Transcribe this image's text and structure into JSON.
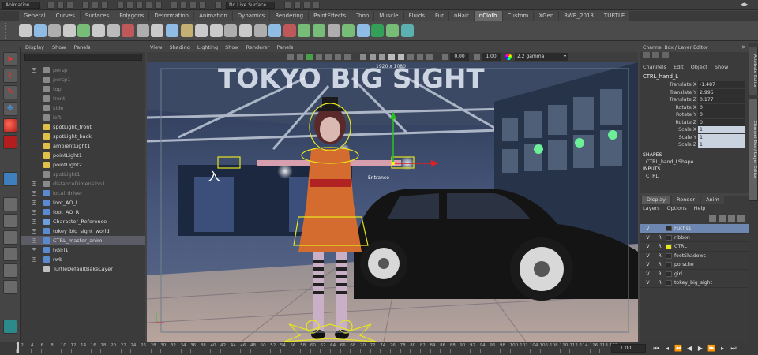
{
  "topbar": {
    "mode_field": "Animation",
    "surface_field": "No Live Surface"
  },
  "shelf_tabs": [
    "General",
    "Curves",
    "Surfaces",
    "Polygons",
    "Deformation",
    "Animation",
    "Dynamics",
    "Rendering",
    "PaintEffects",
    "Toon",
    "Muscle",
    "Fluids",
    "Fur",
    "nHair",
    "nCloth",
    "Custom",
    "XGen",
    "RWB_2013",
    "TURTLE"
  ],
  "active_shelf_tab": "nCloth",
  "outliner": {
    "menu": [
      "Display",
      "Show",
      "Panels"
    ],
    "items": [
      {
        "label": "persp",
        "dim": true,
        "exp": true
      },
      {
        "label": "persp1",
        "dim": true,
        "exp": false
      },
      {
        "label": "top",
        "dim": true,
        "exp": false
      },
      {
        "label": "front",
        "dim": true,
        "exp": false
      },
      {
        "label": "side",
        "dim": true,
        "exp": false
      },
      {
        "label": "left",
        "dim": true,
        "exp": false
      },
      {
        "label": "spotLight_front",
        "dim": false,
        "exp": false
      },
      {
        "label": "spotLight_back",
        "dim": false,
        "exp": false
      },
      {
        "label": "ambientLight1",
        "dim": false,
        "exp": false
      },
      {
        "label": "pointLight1",
        "dim": false,
        "exp": false
      },
      {
        "label": "pointLight2",
        "dim": false,
        "exp": false
      },
      {
        "label": "spotLight1",
        "dim": true,
        "exp": false
      },
      {
        "label": "distanceDimension1",
        "dim": true,
        "exp": true
      },
      {
        "label": "local_driver",
        "dim": true,
        "exp": true
      },
      {
        "label": "foot_AO_L",
        "dim": false,
        "exp": true
      },
      {
        "label": "foot_AO_R",
        "dim": false,
        "exp": true
      },
      {
        "label": "Character_Reference",
        "dim": false,
        "exp": true
      },
      {
        "label": "tokey_big_sight_world",
        "dim": false,
        "exp": true
      },
      {
        "label": "CTRL_master_anim",
        "dim": false,
        "exp": true,
        "sel": true
      },
      {
        "label": "hGirl1",
        "dim": false,
        "exp": true
      },
      {
        "label": "rwb",
        "dim": false,
        "exp": true
      },
      {
        "label": "TurtleDefaultBakeLayer",
        "dim": false,
        "exp": false
      }
    ]
  },
  "viewport": {
    "menu": [
      "View",
      "Shading",
      "Lighting",
      "Show",
      "Renderer",
      "Panels"
    ],
    "exposure": "0.00",
    "gamma_value": "1.00",
    "gamma_mode": "2.2 gamma",
    "resolution_gate": "1920 x 1080",
    "sign_text": "TOKYO BIG SIGHT",
    "entrance_text": "入",
    "entrance_small": "Entrance"
  },
  "channel_box": {
    "header": "Channel Box / Layer Editor",
    "menu": [
      "Channels",
      "Edit",
      "Object",
      "Show"
    ],
    "object": "CTRL_hand_L",
    "attributes": [
      {
        "name": "Translate X",
        "value": "-1.487",
        "hl": false
      },
      {
        "name": "Translate Y",
        "value": "2.995",
        "hl": false
      },
      {
        "name": "Translate Z",
        "value": "0.177",
        "hl": false
      },
      {
        "name": "Rotate X",
        "value": "0",
        "hl": false
      },
      {
        "name": "Rotate Y",
        "value": "0",
        "hl": false
      },
      {
        "name": "Rotate Z",
        "value": "0",
        "hl": false
      },
      {
        "name": "Scale X",
        "value": "1",
        "hl": true
      },
      {
        "name": "Scale Y",
        "value": "1",
        "hl": true
      },
      {
        "name": "Scale Z",
        "value": "1",
        "hl": true
      }
    ],
    "shapes_label": "SHAPES",
    "shape_name": "CTRL_hand_LShape",
    "inputs_label": "INPUTS",
    "input_name": "CTRL"
  },
  "layer_editor": {
    "tabs": [
      "Display",
      "Render",
      "Anim"
    ],
    "menu": [
      "Layers",
      "Options",
      "Help"
    ],
    "layers": [
      {
        "v": "V",
        "r": "",
        "name": "Fuchs1",
        "color": "#2d2d2d",
        "sel": true
      },
      {
        "v": "V",
        "r": "R",
        "name": "ribbon",
        "color": "#2d2d2d",
        "sel": false
      },
      {
        "v": "V",
        "r": "R",
        "name": "CTRL",
        "color": "#e8e81c",
        "sel": false
      },
      {
        "v": "V",
        "r": "R",
        "name": "footShadows",
        "color": "#2d2d2d",
        "sel": false
      },
      {
        "v": "V",
        "r": "R",
        "name": "porsche",
        "color": "#2d2d2d",
        "sel": false
      },
      {
        "v": "V",
        "r": "R",
        "name": "girl",
        "color": "#2d2d2d",
        "sel": false
      },
      {
        "v": "V",
        "r": "R",
        "name": "tokey_big_sight",
        "color": "#2d2d2d",
        "sel": false
      }
    ]
  },
  "side_tabs": [
    "Attribute Editor",
    "Channel Box / Layer Editor"
  ],
  "timeline": {
    "ticks": [
      "1",
      "2",
      "4",
      "6",
      "8",
      "10",
      "12",
      "14",
      "16",
      "18",
      "20",
      "22",
      "24",
      "26",
      "28",
      "30",
      "32",
      "34",
      "36",
      "38",
      "40",
      "42",
      "44",
      "46",
      "48",
      "50",
      "52",
      "54",
      "56",
      "58",
      "60",
      "62",
      "64",
      "66",
      "68",
      "70",
      "72",
      "74",
      "76",
      "78",
      "80",
      "82",
      "84",
      "86",
      "88",
      "90",
      "92",
      "94",
      "96",
      "98",
      "100",
      "102",
      "104",
      "106",
      "108",
      "110",
      "112",
      "114",
      "116",
      "118",
      "120"
    ],
    "current_frame": "1.00"
  }
}
